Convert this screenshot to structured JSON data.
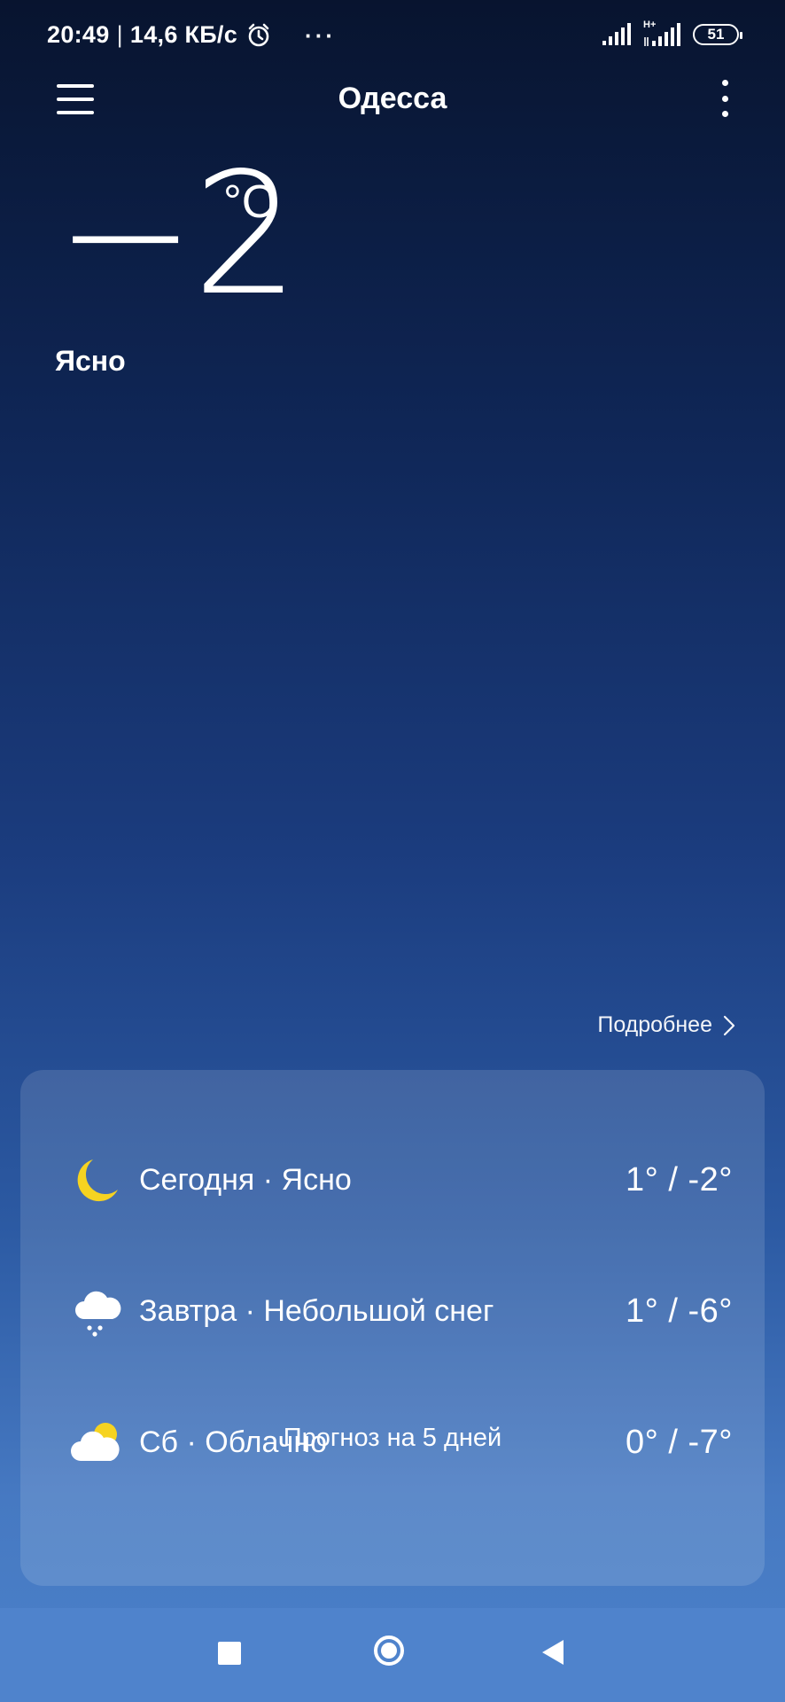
{
  "status_bar": {
    "time": "20:49",
    "separator": "|",
    "speed": "14,6 КБ/с",
    "dots": "···",
    "network_type": "H+",
    "battery_level": "51"
  },
  "header": {
    "city": "Одесса"
  },
  "current": {
    "temperature": "−2",
    "unit": "°C",
    "condition": "Ясно"
  },
  "details_link": "Подробнее",
  "forecast": {
    "rows": [
      {
        "label": "Сегодня · Ясно",
        "range": "1° / -2°",
        "icon": "moon-icon"
      },
      {
        "label": "Завтра · Небольшой снег",
        "range": "1° / -6°",
        "icon": "light-snow-icon"
      },
      {
        "label": "Сб · Облачно",
        "range": "0° / -7°",
        "icon": "partly-cloudy-icon"
      }
    ],
    "five_day_label": "Прогноз на 5 дней"
  },
  "colors": {
    "moon": "#f6d321",
    "sun": "#f6d321",
    "card_bg": "rgba(255,255,255,0.13)",
    "nav_bg": "#4f83cc"
  }
}
